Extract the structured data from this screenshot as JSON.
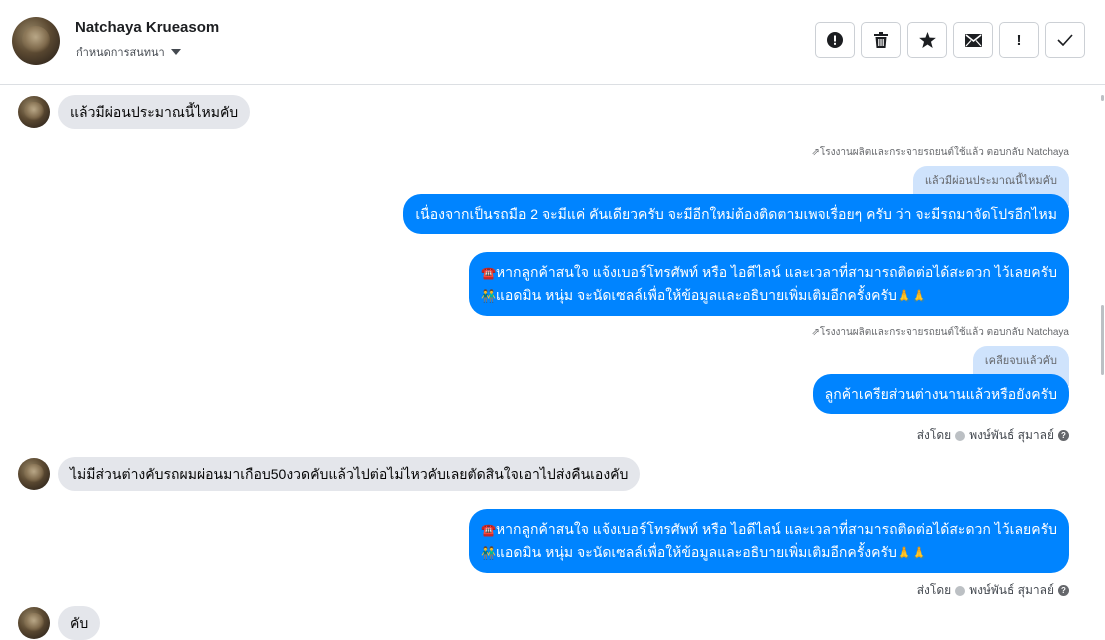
{
  "header": {
    "contact_name": "Natchaya Krueasom",
    "assign_label": "กำหนดการสนทนา",
    "toolbar": [
      {
        "icon": "alert-circle-icon",
        "label": ""
      },
      {
        "icon": "trash-icon",
        "label": ""
      },
      {
        "icon": "star-icon",
        "label": ""
      },
      {
        "icon": "mail-icon",
        "label": ""
      },
      {
        "icon": "exclamation-icon",
        "label": "!"
      },
      {
        "icon": "check-icon",
        "label": ""
      }
    ]
  },
  "messages": {
    "m1": {
      "text": "แล้วมีผ่อนประมาณนี้ไหมคับ"
    },
    "m2": {
      "reply_note": "โรงงานผลิตและกระจายรถยนต์ใช้แล้ว ตอบกลับ Natchaya",
      "quote": "แล้วมีผ่อนประมาณนี้ไหมคับ",
      "text": "เนื่องจากเป็นรถมือ 2 จะมีแค่ คันเดียวครับ จะมีอีกใหม่ต้องติดตามเพจเรื่อยๆ ครับ ว่า จะมีรถมาจัดโปรอีกไหม"
    },
    "m3": {
      "line1_emoji": "☎️",
      "line1": "หากลูกค้าสนใจ แจ้งเบอร์โทรศัพท์ หรือ ไอดีไลน์ และเวลาที่สามารถติดต่อได้สะดวก ไว้เลยครับ",
      "line2_emoji": "👬",
      "line2": "แอดมิน หนุ่ม จะนัดเซลล์เพื่อให้ข้อมูลและอธิบายเพิ่มเติมอีกครั้งครับ",
      "line2_end": "🙏🙏"
    },
    "m4": {
      "reply_note": "โรงงานผลิตและกระจายรถยนต์ใช้แล้ว ตอบกลับ Natchaya",
      "quote": "เคลียจบแล้วคับ",
      "text": "ลูกค้าเครียส่วนต่างนานแล้วหรือยังครับ",
      "sent_by_label": "ส่งโดย",
      "sent_by_name": "พงษ์พันธ์ สุมาลย์"
    },
    "m5": {
      "text": "ไม่มีส่วนต่างคับรถผมผ่อนมาเกือบ50งวดคับแล้วไปต่อไม่ไหวคับเลยตัดสินใจเอาไปส่งคืนเองคับ"
    },
    "m6": {
      "line1_emoji": "☎️",
      "line1": "หากลูกค้าสนใจ แจ้งเบอร์โทรศัพท์ หรือ ไอดีไลน์ และเวลาที่สามารถติดต่อได้สะดวก ไว้เลยครับ",
      "line2_emoji": "👬",
      "line2": "แอดมิน หนุ่ม จะนัดเซลล์เพื่อให้ข้อมูลและอธิบายเพิ่มเติมอีกครั้งครับ",
      "line2_end": "🙏🙏",
      "sent_by_label": "ส่งโดย",
      "sent_by_name": "พงษ์พันธ์ สุมาลย์"
    },
    "m7": {
      "text": "คับ"
    }
  },
  "colors": {
    "outgoing_bubble": "#0084ff",
    "incoming_bubble": "#e4e6eb",
    "quote_bubble": "#cfe3fc"
  }
}
